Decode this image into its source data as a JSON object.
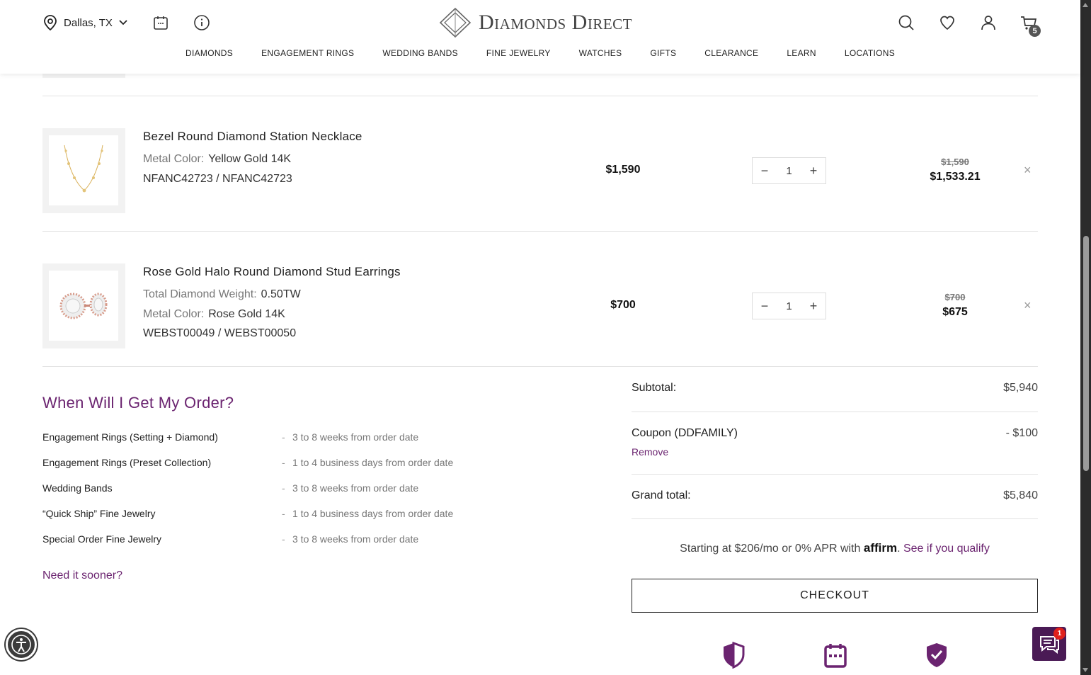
{
  "header": {
    "location": "Dallas, TX",
    "brand": "Diamonds Direct",
    "cart_count": "5",
    "nav": [
      "DIAMONDS",
      "ENGAGEMENT RINGS",
      "WEDDING BANDS",
      "FINE JEWELRY",
      "WATCHES",
      "GIFTS",
      "CLEARANCE",
      "LEARN",
      "LOCATIONS"
    ]
  },
  "cart": {
    "items": [
      {
        "title": "Bezel Round Diamond Station Necklace",
        "lines": [
          {
            "label": "Metal Color:",
            "value": "Yellow Gold 14K"
          },
          {
            "label": "",
            "value": "NFANC42723 / NFANC42723"
          }
        ],
        "price": "$1,590",
        "quantity": "1",
        "original_total": "$1,590",
        "final_total": "$1,533.21",
        "remove_glyph": "×"
      },
      {
        "title": "Rose Gold Halo Round Diamond Stud Earrings",
        "lines": [
          {
            "label": "Total Diamond Weight:",
            "value": "0.50TW"
          },
          {
            "label": "Metal Color:",
            "value": "Rose Gold 14K"
          },
          {
            "label": "",
            "value": "WEBST00049 / WEBST00050"
          }
        ],
        "price": "$700",
        "quantity": "1",
        "original_total": "$700",
        "final_total": "$675",
        "remove_glyph": "×"
      }
    ],
    "qty_minus": "−",
    "qty_plus": "+"
  },
  "delivery": {
    "title": "When Will I Get My Order?",
    "rows": [
      {
        "name": "Engagement Rings (Setting + Diamond)",
        "dash": "-",
        "time": "3 to 8 weeks from order date"
      },
      {
        "name": "Engagement Rings (Preset Collection)",
        "dash": "-",
        "time": "1 to 4 business days from order date"
      },
      {
        "name": "Wedding Bands",
        "dash": "-",
        "time": "3 to 8 weeks from order date"
      },
      {
        "name": "“Quick Ship” Fine Jewelry",
        "dash": "-",
        "time": "1 to 4 business days from order date"
      },
      {
        "name": "Special Order Fine Jewelry",
        "dash": "-",
        "time": "3 to 8 weeks from order date"
      }
    ],
    "sooner_link": "Need it sooner?"
  },
  "summary": {
    "subtotal_label": "Subtotal:",
    "subtotal_value": "$5,940",
    "coupon_label": "Coupon (DDFAMILY)",
    "coupon_value": "- $100",
    "coupon_remove": "Remove",
    "grand_label": "Grand total:",
    "grand_value": "$5,840",
    "affirm_prefix": "Starting at $206/mo or 0% APR with",
    "affirm_brand": "affirm",
    "affirm_link": "See if you qualify",
    "checkout_label": "CHECKOUT"
  },
  "widgets": {
    "chat_badge": "1"
  },
  "colors": {
    "accent": "#6b2470",
    "chat_bg": "#4a1a55",
    "badge_red": "#e0201c"
  },
  "icons": [
    "location-pin-icon",
    "chevron-down-icon",
    "calendar-icon",
    "info-icon",
    "search-icon",
    "heart-icon",
    "user-icon",
    "cart-icon",
    "close-icon",
    "shield-icon",
    "calendar-icon",
    "check-shield-icon",
    "accessibility-icon",
    "chat-icon"
  ]
}
